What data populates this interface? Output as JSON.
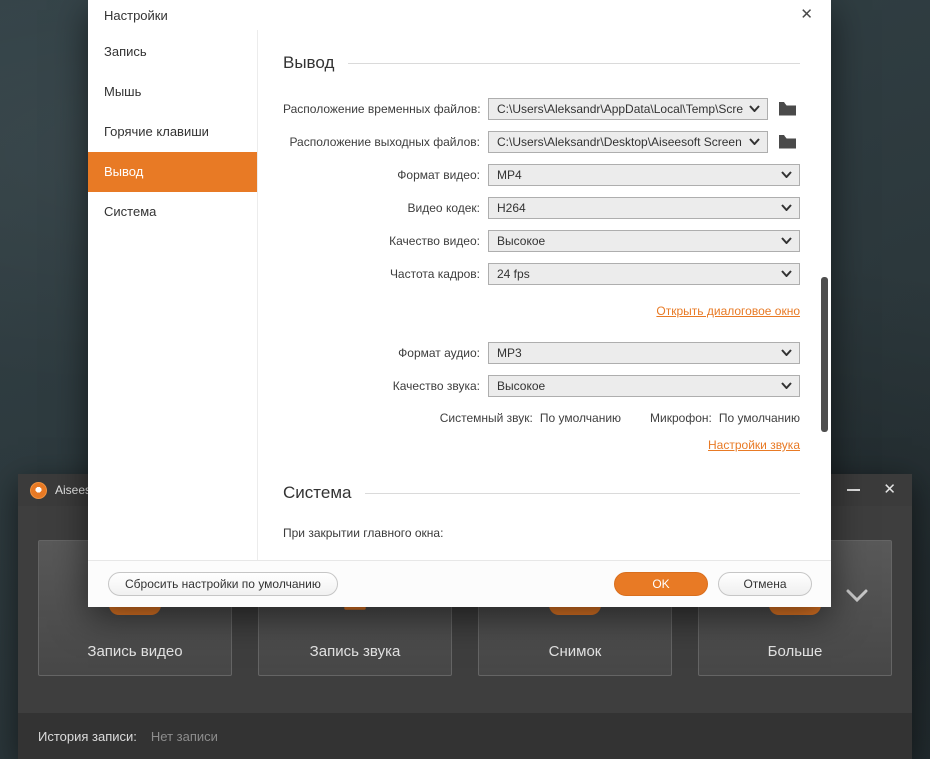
{
  "colors": {
    "accent": "#e87a25"
  },
  "glyphs": {
    "close": "✕"
  },
  "app": {
    "title": "Aisees",
    "cards": [
      {
        "label": "Запись видео"
      },
      {
        "label": "Запись звука"
      },
      {
        "label": "Снимок"
      },
      {
        "label": "Больше"
      }
    ],
    "history_label": "История записи:",
    "history_value": "Нет записи"
  },
  "settings": {
    "title": "Настройки",
    "sidebar": [
      "Запись",
      "Мышь",
      "Горячие клавиши",
      "Вывод",
      "Система"
    ],
    "output": {
      "heading": "Вывод",
      "rows": [
        {
          "label": "Расположение временных файлов:",
          "value": "C:\\Users\\Aleksandr\\AppData\\Local\\Temp\\Screen R"
        },
        {
          "label": "Расположение выходных файлов:",
          "value": "C:\\Users\\Aleksandr\\Desktop\\Aiseesoft Screen Rec"
        },
        {
          "label": "Формат видео:",
          "value": "MP4"
        },
        {
          "label": "Видео кодек:",
          "value": "H264"
        },
        {
          "label": "Качество видео:",
          "value": "Высокое"
        },
        {
          "label": "Частота кадров:",
          "value": "24 fps"
        }
      ],
      "open_dialog_link": "Открыть диалоговое окно",
      "audio_rows": [
        {
          "label": "Формат аудио:",
          "value": "MP3"
        },
        {
          "label": "Качество звука:",
          "value": "Высокое"
        }
      ],
      "system_sound_label": "Системный звук:",
      "system_sound_value": "По умолчанию",
      "microphone_label": "Микрофон:",
      "microphone_value": "По умолчанию",
      "sound_settings_link": "Настройки звука"
    },
    "system": {
      "heading": "Система",
      "on_close_label": "При закрытии главного окна:"
    },
    "footer": {
      "reset": "Сбросить настройки по умолчанию",
      "ok": "OK",
      "cancel": "Отмена"
    }
  }
}
